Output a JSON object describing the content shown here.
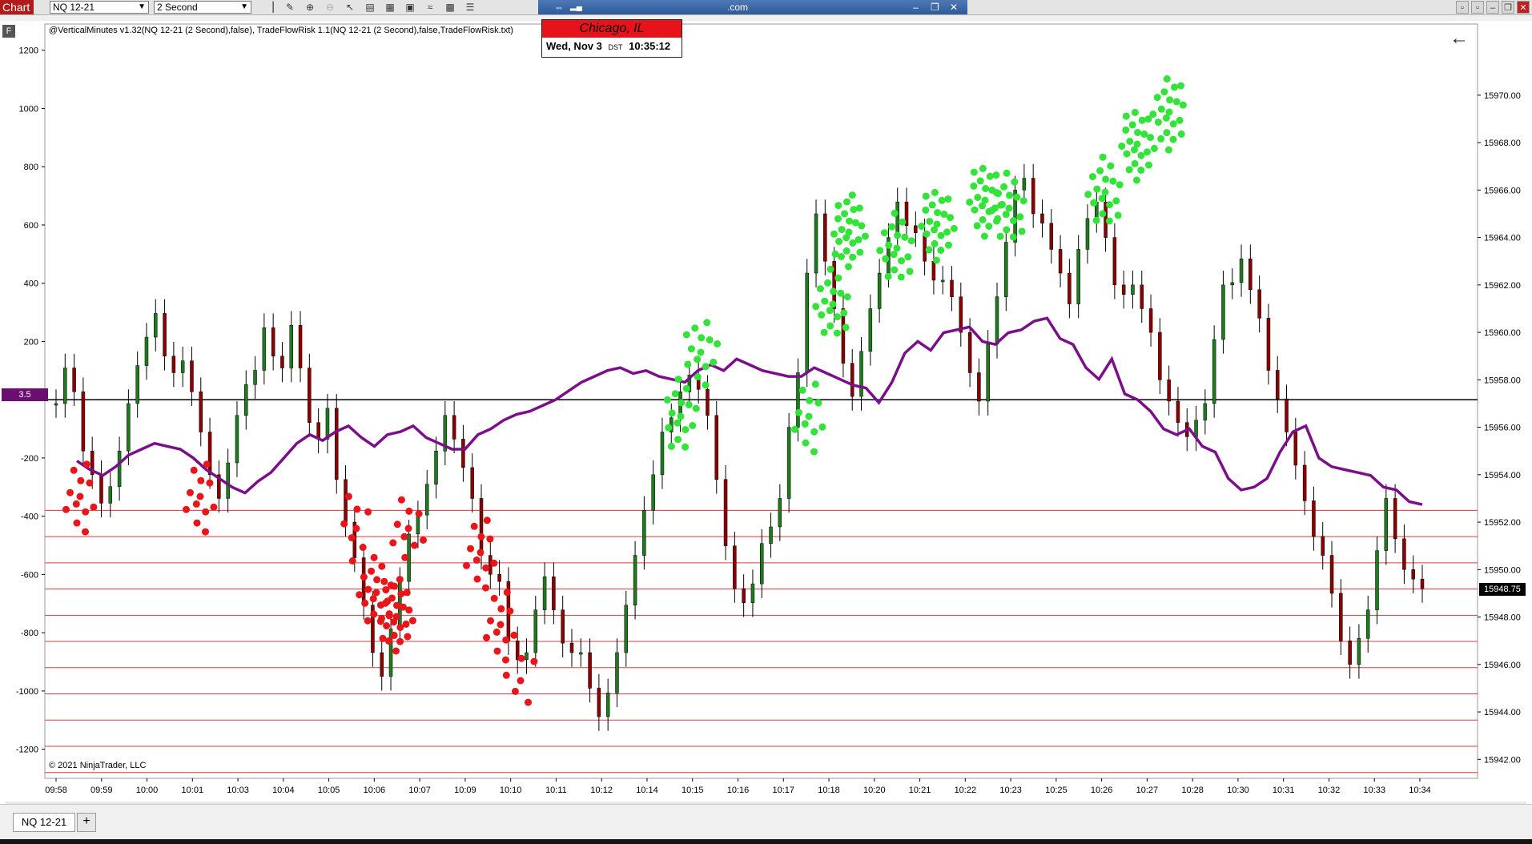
{
  "toolbar": {
    "chart_label": "Chart",
    "instrument": "NQ 12-21",
    "interval": "2 Second",
    "connection_text": ".com"
  },
  "indicator_label": "@VerticalMinutes v1.32(NQ 12-21 (2 Second),false), TradeFlowRisk 1.1(NQ 12-21 (2 Second),false,TradeFlowRisk.txt)",
  "clock": {
    "city": "Chicago, IL",
    "date": "Wed, Nov 3",
    "dst": "DST",
    "time": "10:35:12"
  },
  "copyright": "© 2021 NinjaTrader, LLC",
  "left_tag": "3.5",
  "last_price": "15948.75",
  "tab": {
    "label": "NQ 12-21",
    "add": "+"
  },
  "colors": {
    "price_up": "#1f7a1f",
    "price_down": "#8b0000",
    "indicator_line": "#7b0f8a",
    "buy_dot": "#33e33a",
    "sell_dot": "#e8151a",
    "level_line": "#e3393c",
    "clock_bg": "#e8121b"
  },
  "chart_data": {
    "type": "line",
    "instrument": "NQ 12-21",
    "interval": "2 Second",
    "x_labels": [
      "09:58",
      "09:59",
      "10:00",
      "10:01",
      "10:03",
      "10:04",
      "10:05",
      "10:06",
      "10:07",
      "10:09",
      "10:10",
      "10:11",
      "10:12",
      "10:14",
      "10:15",
      "10:16",
      "10:17",
      "10:18",
      "10:20",
      "10:21",
      "10:22",
      "10:23",
      "10:25",
      "10:26",
      "10:27",
      "10:28",
      "10:30",
      "10:31",
      "10:32",
      "10:33",
      "10:34"
    ],
    "left_axis": {
      "ylim": [
        -1300,
        1290
      ],
      "ticks": [
        1200,
        1000,
        800,
        600,
        400,
        200,
        -200,
        -400,
        -600,
        -800,
        -1000,
        -1200
      ]
    },
    "right_axis": {
      "ylim": [
        15941.2,
        15973.0
      ],
      "ticks": [
        15970,
        15968,
        15966,
        15964,
        15962,
        15960,
        15958,
        15956,
        15954,
        15952,
        15950,
        15948,
        15946,
        15944,
        15942
      ]
    },
    "zero_line_value": 0,
    "horizontal_levels": [
      -380,
      -470,
      -560,
      -650,
      -740,
      -830,
      -920,
      -1010,
      -1100,
      -1190,
      -1280
    ],
    "series": [
      {
        "name": "NQ 12-21",
        "axis": "right",
        "values": [
          15957.0,
          15958.5,
          15957.5,
          15955.0,
          15954.0,
          15952.8,
          15953.5,
          15955.0,
          15957.0,
          15958.6,
          15959.8,
          15960.8,
          15959.0,
          15958.3,
          15958.8,
          15957.5,
          15955.8,
          15954.0,
          15953.0,
          15954.5,
          15956.5,
          15957.8,
          15958.4,
          15960.2,
          15959.0,
          15958.5,
          15960.3,
          15958.5,
          15956.2,
          15955.5,
          15956.8,
          15953.8,
          15952.0,
          15950.5,
          15948.5,
          15946.5,
          15945.5,
          15947.5,
          15949.5,
          15951.5,
          15952.3,
          15953.6,
          15955.0,
          15956.5,
          15955.5,
          15954.3,
          15953.0,
          15950.6,
          15949.8,
          15949.5,
          15947.0,
          15946.2,
          15946.5,
          15948.3,
          15949.7,
          15948.3,
          15946.9,
          15946.5,
          15946.5,
          15945.0,
          15943.8,
          15944.8,
          15946.5,
          15948.5,
          15950.6,
          15952.5,
          15954.0,
          15955.8,
          15956.4,
          15957.5,
          15958.2,
          15957.6,
          15956.5,
          15953.8,
          15951.0,
          15949.2,
          15948.6,
          15949.4,
          15951.1,
          15951.8,
          15953.0,
          15956.0,
          15958.3,
          15962.5,
          15965.0,
          15963.0,
          15961.0,
          15958.7,
          15957.3,
          15959.2,
          15961.0,
          15962.5,
          15964.0,
          15965.5,
          15964.5,
          15964.2,
          15963.0,
          15962.2,
          15962.2,
          15961.5,
          15960.0,
          15958.3,
          15957.1,
          15959.5,
          15961.5,
          15963.8,
          15966.0,
          15966.5,
          15965.0,
          15964.6,
          15963.5,
          15962.5,
          15961.2,
          15963.5,
          15964.8,
          15965.5,
          15964.0,
          15962.0,
          15961.6,
          15962.0,
          15961.0,
          15960.0,
          15958.0,
          15957.1,
          15956.2,
          15955.6,
          15956.3,
          15957.0,
          15959.7,
          15962.0,
          15962.1,
          15963.1,
          15961.8,
          15960.6,
          15958.4,
          15957.2,
          15955.8,
          15954.4,
          15952.9,
          15951.4,
          15950.6,
          15949.0,
          15947.0,
          15946.0,
          15947.1,
          15948.3,
          15950.8,
          15953.0,
          15951.3,
          15950.0,
          15949.6,
          15949.2
        ]
      },
      {
        "name": "TradeFlowRisk",
        "axis": "left",
        "values": [
          -210,
          -240,
          -260,
          -230,
          -190,
          -170,
          -150,
          -160,
          -170,
          -200,
          -240,
          -270,
          -300,
          -320,
          -280,
          -250,
          -200,
          -150,
          -120,
          -140,
          -110,
          -90,
          -130,
          -160,
          -120,
          -110,
          -90,
          -130,
          -150,
          -170,
          -170,
          -120,
          -100,
          -70,
          -50,
          -40,
          -20,
          0,
          30,
          60,
          80,
          100,
          110,
          90,
          100,
          80,
          70,
          60,
          100,
          120,
          100,
          140,
          120,
          100,
          90,
          80,
          80,
          110,
          90,
          70,
          50,
          40,
          -10,
          60,
          160,
          200,
          170,
          230,
          240,
          250,
          200,
          190,
          230,
          240,
          270,
          280,
          210,
          190,
          110,
          70,
          140,
          20,
          0,
          -40,
          -100,
          -120,
          -100,
          -160,
          -180,
          -270,
          -310,
          -300,
          -270,
          -180,
          -110,
          -90,
          -200,
          -230,
          -240,
          -250,
          -260,
          -300,
          -310,
          -350,
          -360
        ]
      }
    ]
  }
}
